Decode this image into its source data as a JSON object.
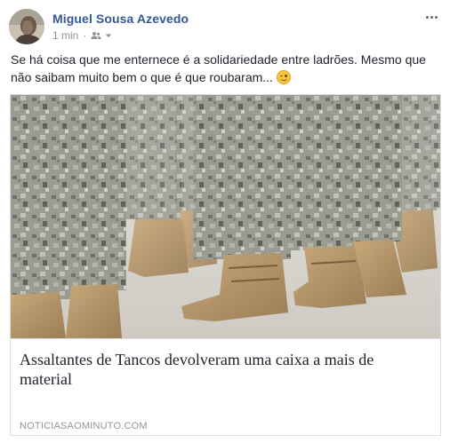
{
  "post": {
    "author": "Miguel Sousa Azevedo",
    "time": "1 min",
    "audience_icon": "friends-icon",
    "text": "Se há coisa que me enternece é a solidariedade entre ladrões. Mesmo que não saibam muito bem o que é que roubaram...",
    "emoji": "winking-face-emoji"
  },
  "link": {
    "image": "soldiers-boots-photo",
    "title": "Assaltantes de Tancos devolveram uma caixa a mais de material",
    "domain": "NOTICIASAOMINUTO.COM"
  },
  "colors": {
    "author": "#365899",
    "meta": "#90949c",
    "text": "#1d2129",
    "border": "#dddfe2"
  }
}
